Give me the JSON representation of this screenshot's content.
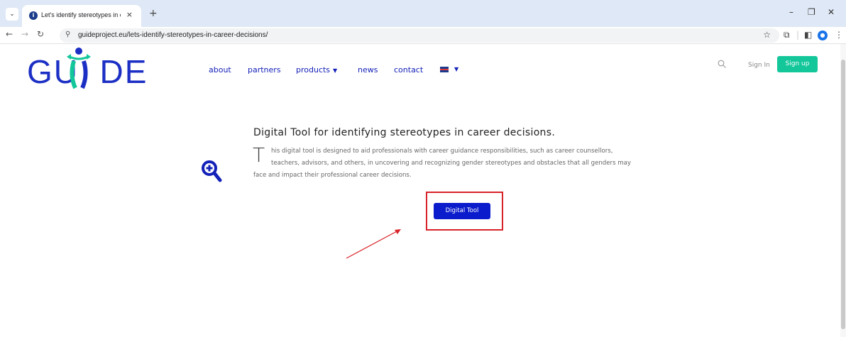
{
  "browser": {
    "tab_title": "Let's identify stereotypes in care",
    "tab_close": "×",
    "new_tab": "+",
    "url": "guideproject.eu/lets-identify-stereotypes-in-career-decisions/",
    "window_controls": [
      "–",
      "❐",
      "✕"
    ]
  },
  "site": {
    "logo_text": "GU  DE",
    "nav": [
      {
        "label": "about"
      },
      {
        "label": "partners"
      },
      {
        "label": "products"
      },
      {
        "label": "news"
      },
      {
        "label": "contact"
      }
    ],
    "sign_in": "Sign In",
    "sign_up": "Sign up",
    "colors": {
      "brand": "#1c2fc4",
      "nav": "#1421b8",
      "signup": "#13c79b",
      "cta": "#0b1ccc",
      "highlight": "#d9232a"
    }
  },
  "content": {
    "heading": "Digital Tool for identifying stereotypes in career decisions.",
    "dropcap": "T",
    "paragraph_lines": [
      "his digital tool is designed to aid professionals with career guidance responsibilities, such as career counsellors,",
      "teachers, advisors, and others, in uncovering and recognizing gender stereotypes and obstacles that all genders may",
      "face and impact their professional career decisions."
    ],
    "cta_label": "Digital Tool"
  }
}
